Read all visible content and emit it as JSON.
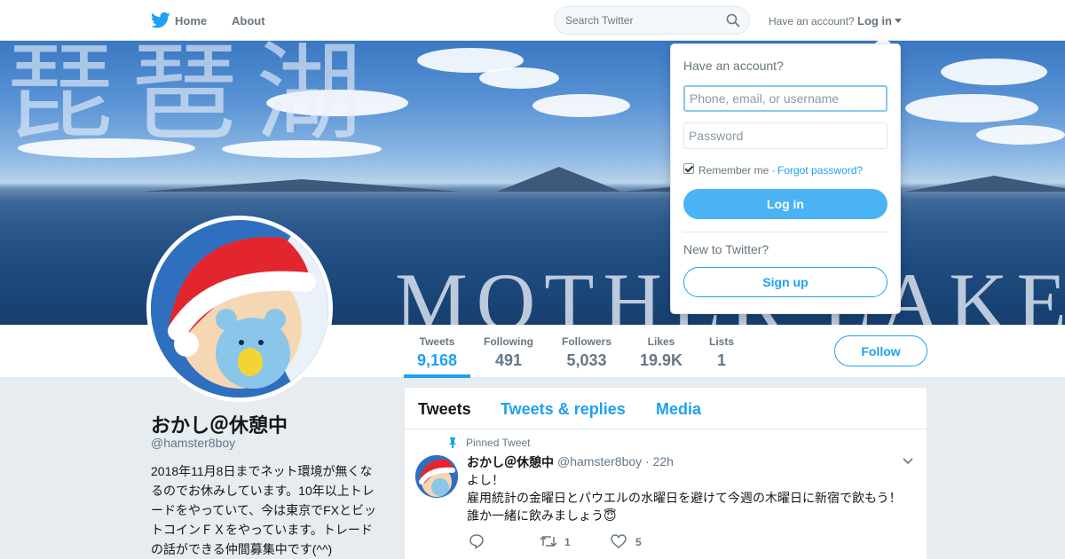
{
  "nav": {
    "logo_icon": "twitter-bird-icon",
    "home_label": "Home",
    "about_label": "About",
    "search_placeholder": "Search Twitter",
    "have_account_label": "Have an account?",
    "login_label": "Log in"
  },
  "banner": {
    "kanji_text": "琵琶湖",
    "english_text": "MOTHER LAKE"
  },
  "profile": {
    "name": "おかし＠休憩中",
    "handle": "@hamster8boy",
    "bio": "2018年11月8日までネット環境が無くなるのでお休みしています。10年以上トレードをやっていて、今は東京でFXとビットコインＦＸをやっています。トレードの話ができる仲間募集中です(^^)"
  },
  "stats": [
    {
      "label": "Tweets",
      "value": "9,168"
    },
    {
      "label": "Following",
      "value": "491"
    },
    {
      "label": "Followers",
      "value": "5,033"
    },
    {
      "label": "Likes",
      "value": "19.9K"
    },
    {
      "label": "Lists",
      "value": "1"
    }
  ],
  "follow_label": "Follow",
  "timeline": {
    "tabs": [
      "Tweets",
      "Tweets & replies",
      "Media"
    ],
    "pinned_label": "Pinned Tweet",
    "tweet": {
      "name": "おかし＠休憩中",
      "meta": "@hamster8boy · 22h",
      "text": "よし！\n雇用統計の金曜日とパウエルの水曜日を避けて今週の木曜日に新宿で飲もう！\n誰か一緒に飲みましょう😇",
      "retweets": "1",
      "likes": "5"
    }
  },
  "login_dropdown": {
    "title": "Have an account?",
    "username_placeholder": "Phone, email, or username",
    "password_placeholder": "Password",
    "remember_label": "Remember me ·",
    "forgot_label": "Forgot password?",
    "login_button": "Log in",
    "new_label": "New to Twitter?",
    "signup_button": "Sign up"
  },
  "colors": {
    "accent": "#1da1f2",
    "login_button": "#4ab3f4",
    "text_secondary": "#657786"
  }
}
